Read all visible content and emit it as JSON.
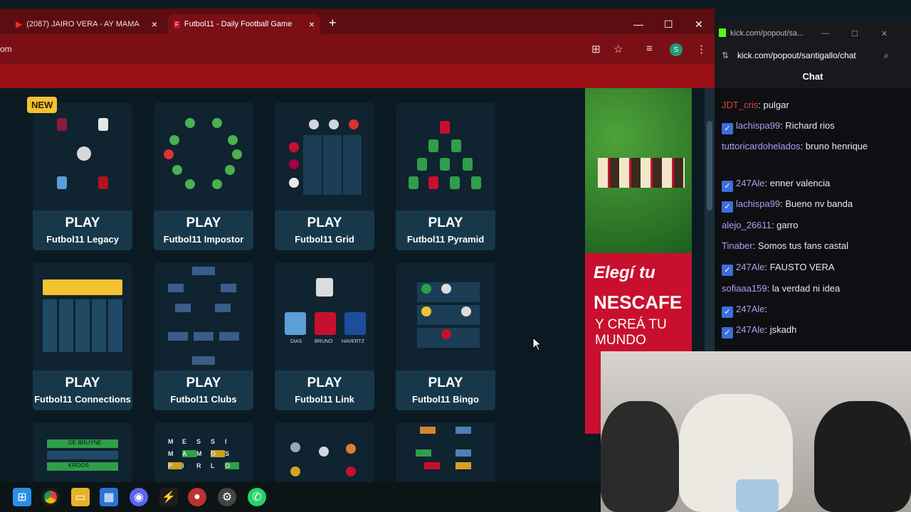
{
  "browser": {
    "tabs": [
      {
        "label": "(2087) JAIRO VERA - AY MAMA",
        "active": false
      },
      {
        "label": "Futbol11 - Daily Football Game",
        "active": true
      }
    ],
    "url": "om"
  },
  "games": [
    {
      "play": "PLAY",
      "name": "Futbol11 Legacy",
      "badge": "NEW"
    },
    {
      "play": "PLAY",
      "name": "Futbol11 Impostor"
    },
    {
      "play": "PLAY",
      "name": "Futbol11 Grid"
    },
    {
      "play": "PLAY",
      "name": "Futbol11 Pyramid"
    },
    {
      "play": "PLAY",
      "name": "Futbol11 Connections"
    },
    {
      "play": "PLAY",
      "name": "Futbol11 Clubs"
    },
    {
      "play": "PLAY",
      "name": "Futbol11 Link"
    },
    {
      "play": "PLAY",
      "name": "Futbol11 Bingo"
    }
  ],
  "thumb_text": {
    "link": [
      "DIAS",
      "BRUNO",
      "HAVERTZ"
    ],
    "connections_row3": [
      "DE BRUYNE",
      "KROOS"
    ],
    "letters": [
      "M",
      "E",
      "S",
      "S",
      "I",
      "M",
      "A",
      "M",
      "O",
      "S",
      "P",
      "I",
      "R",
      "L",
      "O"
    ]
  },
  "ad": {
    "line1": "Elegí tu",
    "brand": "NESCAFE",
    "line3": "Y CREÁ TU MUNDO"
  },
  "chat": {
    "window_title": "kick.com/popout/sa...",
    "address": "kick.com/popout/santigallo/chat",
    "header": "Chat",
    "messages": [
      {
        "user": "JDT_cris",
        "text": "pulgar",
        "color": "#e0413a",
        "badge": false
      },
      {
        "user": "lachispa99",
        "text": "Richard rios",
        "color": "#b79af2",
        "badge": true
      },
      {
        "user": "tuttoricardohelados",
        "text": "bruno henrique",
        "color": "#b79af2",
        "badge": false
      },
      {
        "user": "247Ale",
        "text": "enner valencia",
        "color": "#b79af2",
        "badge": true
      },
      {
        "user": "lachispa99",
        "text": "Bueno nv banda",
        "color": "#b79af2",
        "badge": true
      },
      {
        "user": "alejo_26611",
        "text": "garro",
        "color": "#b79af2",
        "badge": false
      },
      {
        "user": "Tinaber",
        "text": "Somos tus fans castal",
        "color": "#b79af2",
        "badge": false
      },
      {
        "user": "247Ale",
        "text": "FAUSTO VERA",
        "color": "#b79af2",
        "badge": true
      },
      {
        "user": "sofiaaa159",
        "text": "la verdad ni idea",
        "color": "#b79af2",
        "badge": false
      },
      {
        "user": "247Ale",
        "text": "",
        "color": "#b79af2",
        "badge": true
      },
      {
        "user": "247Ale",
        "text": "jskadh",
        "color": "#b79af2",
        "badge": true
      }
    ]
  },
  "colors": {
    "tabbar": "#5d0d12",
    "toolbar": "#7a1016",
    "accent": "#9b0f17",
    "card": "#122a38"
  }
}
